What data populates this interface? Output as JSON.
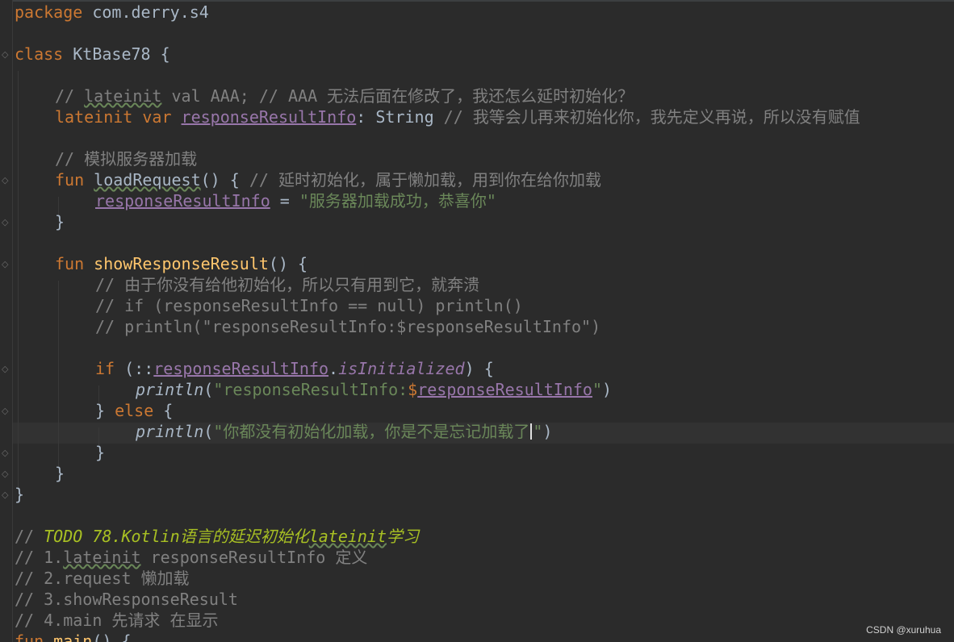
{
  "code": {
    "l01_pkg_kw": "package",
    "l01_pkg_name": " com.derry.s4",
    "l02_class_kw": "class",
    "l02_class_name": " KtBase78 {",
    "l03_comment_a": "// ",
    "l03_comment_lateinit": "lateinit",
    "l03_comment_b": " val AAA; // AAA 无法后面在修改了，我还怎么延时初始化？",
    "l04_kw": "lateinit var",
    "l04_prop": "responseResultInfo",
    "l04_type": ": String ",
    "l04_comment": "// 我等会儿再来初始化你，我先定义再说，所以没有赋值",
    "l05_comment": "// 模拟服务器加载",
    "l06_kw": "fun",
    "l06_fn": "loadRequest",
    "l06_rest": "() { ",
    "l06_comment": "// 延时初始化，属于懒加载，用到你在给你加载",
    "l07_prop": "responseResultInfo",
    "l07_op": " = ",
    "l07_str": "\"服务器加载成功，恭喜你\"",
    "l08_brace": "}",
    "l09_kw": "fun",
    "l09_fn": "showResponseResult",
    "l09_rest": "() {",
    "l10_comment": "// 由于你没有给他初始化，所以只有用到它，就奔溃",
    "l11_comment": "// if (responseResultInfo == null) println()",
    "l12_comment": "// println(\"responseResultInfo:$responseResultInfo\")",
    "l13_kw": "if",
    "l13_a": " (::",
    "l13_prop": "responseResultInfo",
    "l13_dot": ".",
    "l13_init": "isInitialized",
    "l13_b": ") {",
    "l14_fn": "println",
    "l14_a": "(",
    "l14_str": "\"responseResultInfo:",
    "l14_dollar": "$",
    "l14_prop": "responseResultInfo",
    "l14_strend": "\"",
    "l14_b": ")",
    "l15_a": "} ",
    "l15_kw": "else",
    "l15_b": " {",
    "l16_fn": "println",
    "l16_a": "(",
    "l16_str": "\"你都没有初始化加载，你是不是忘记加载了",
    "l16_strend": "\"",
    "l16_b": ")",
    "l17_brace": "}",
    "l18_brace": "}",
    "l19_brace": "}",
    "l20_slash": "// ",
    "l20_todo_a": "TODO 78.Kotlin语言的延迟初始化",
    "l20_todo_b": "lateinit",
    "l20_todo_c": "学习",
    "l21_a": "// 1.",
    "l21_b": "lateinit",
    "l21_c": " responseResultInfo 定义",
    "l22": "// 2.request 懒加载",
    "l23": "// 3.showResponseResult",
    "l24": "// 4.main 先请求 在显示",
    "l25_kw": "fun",
    "l25_fn": " main",
    "l25_rest": "() {"
  },
  "watermark": "CSDN @xuruhua",
  "colors": {
    "background": "#2b2b2b",
    "keyword": "#cc7832",
    "comment": "#808080",
    "string": "#6a8759",
    "function": "#ffc66d",
    "property": "#9876aa",
    "todo": "#a8c023",
    "text": "#a9b7c6"
  }
}
